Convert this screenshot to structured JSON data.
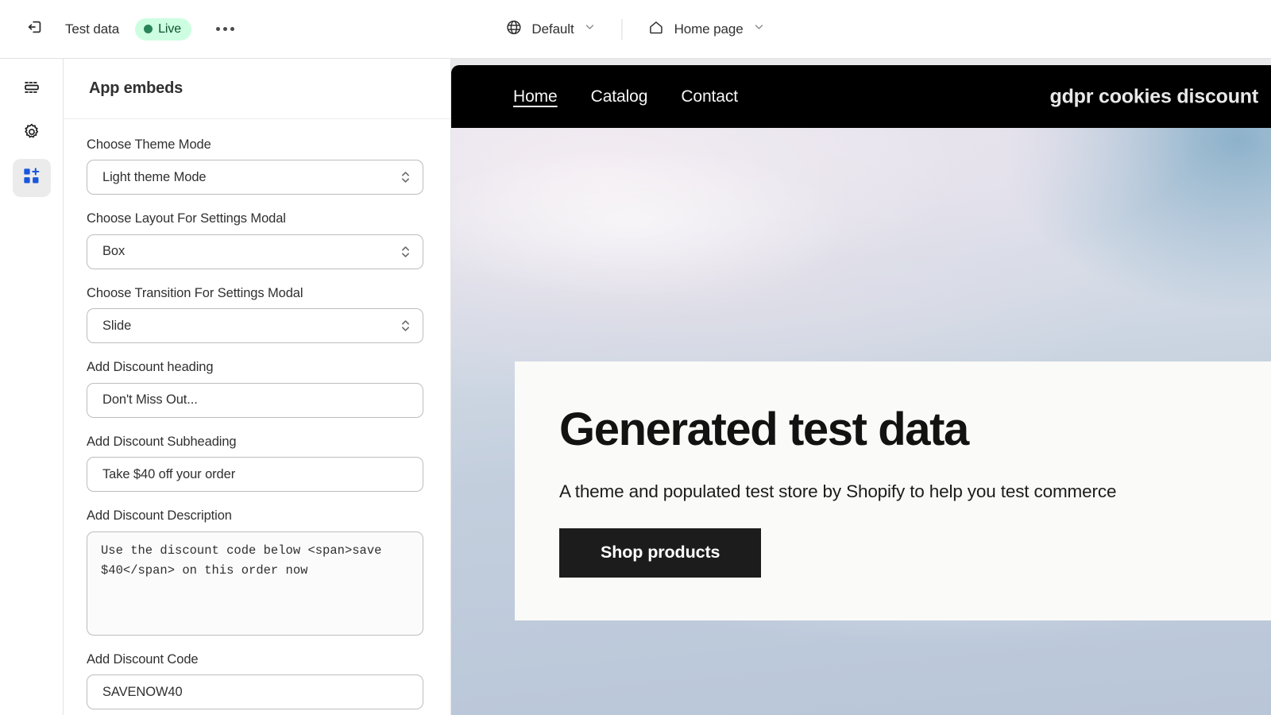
{
  "topbar": {
    "exit_icon": "exit-icon",
    "theme_name": "Test data",
    "status_badge": "Live",
    "more_icon": "ellipsis-icon",
    "locale_icon": "globe-icon",
    "locale_label": "Default",
    "page_icon": "home-icon",
    "page_label": "Home page",
    "chevron_icon": "chevron-down-icon"
  },
  "rail": {
    "items": [
      {
        "name": "sections-icon",
        "label": "Sections",
        "active": false
      },
      {
        "name": "theme-settings-icon",
        "label": "Theme settings",
        "active": false
      },
      {
        "name": "app-embeds-icon",
        "label": "App embeds",
        "active": true
      }
    ]
  },
  "panel": {
    "title": "App embeds",
    "fields": [
      {
        "type": "select",
        "label": "Choose Theme Mode",
        "value": "Light theme Mode"
      },
      {
        "type": "select",
        "label": "Choose Layout For Settings Modal",
        "value": "Box"
      },
      {
        "type": "select",
        "label": "Choose Transition For Settings Modal",
        "value": "Slide"
      },
      {
        "type": "text",
        "label": "Add Discount heading",
        "value": "Don't Miss Out..."
      },
      {
        "type": "text",
        "label": "Add Discount Subheading",
        "value": "Take $40 off your order"
      },
      {
        "type": "textarea",
        "label": "Add Discount Description",
        "value": "Use the discount code below <span>save $40</span> on this order now"
      },
      {
        "type": "text",
        "label": "Add Discount Code",
        "value": "SAVENOW40"
      }
    ]
  },
  "preview": {
    "nav": {
      "links": [
        {
          "label": "Home",
          "active": true
        },
        {
          "label": "Catalog",
          "active": false
        },
        {
          "label": "Contact",
          "active": false
        }
      ],
      "logo": "gdpr cookies discount"
    },
    "hero": {
      "title": "Generated test data",
      "subtitle": "A theme and populated test store by Shopify to help you test commerce",
      "button": "Shop products"
    }
  },
  "colors": {
    "accent": "#1a73e8",
    "badge_bg": "#cdfee1",
    "badge_fg": "#0c5132",
    "badge_dot": "#29845a",
    "ink": "#303030",
    "store_bar": "#000000",
    "hero_card": "#fafaf8",
    "hero_button": "#1c1c1c"
  }
}
